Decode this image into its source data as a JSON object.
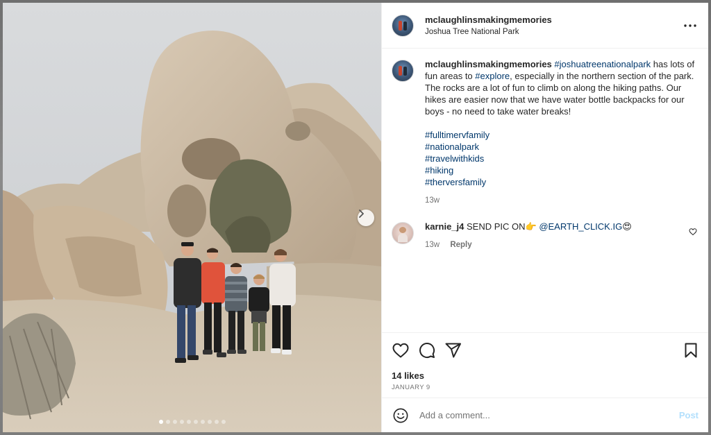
{
  "post": {
    "username": "mclaughlinsmakingmemories",
    "location": "Joshua Tree National Park"
  },
  "caption": {
    "username": "mclaughlinsmakingmemories",
    "parts": [
      {
        "text": "#joshuatreenationalpark",
        "hashtag": true
      },
      {
        "text": " has lots of fun areas to ",
        "hashtag": false
      },
      {
        "text": "#explore",
        "hashtag": true
      },
      {
        "text": ", especially in the northern section of the park. The rocks are a lot of fun to climb on along the hiking paths. Our hikes are easier now that we have water bottle backpacks for our boys - no need to take water breaks!",
        "hashtag": false
      }
    ],
    "tags": [
      "#fulltimervfamily",
      "#nationalpark",
      "#travelwithkids",
      "#hiking",
      "#therversfamily"
    ],
    "time": "13w"
  },
  "comments": [
    {
      "username": "karnie_j4",
      "text_before": " SEND PIC ON👉 ",
      "mention": "@EARTH_CLICK.IG",
      "text_after": "😍",
      "time": "13w",
      "reply_label": "Reply"
    }
  ],
  "stats": {
    "likes": "14 likes",
    "date": "JANUARY 9"
  },
  "composer": {
    "placeholder": "Add a comment...",
    "post_label": "Post"
  },
  "carousel": {
    "total": 10,
    "active_index": 0
  },
  "icons": {
    "more": "more-horizontal-icon",
    "like": "heart-outline-icon",
    "comment": "comment-bubble-icon",
    "share": "paper-plane-icon",
    "save": "bookmark-icon",
    "emoji": "smiley-icon",
    "next": "chevron-right-icon"
  },
  "colors": {
    "hashtag": "#00376b",
    "muted": "#737373",
    "post_disabled": "#b2dffc",
    "divider": "#efefef"
  }
}
